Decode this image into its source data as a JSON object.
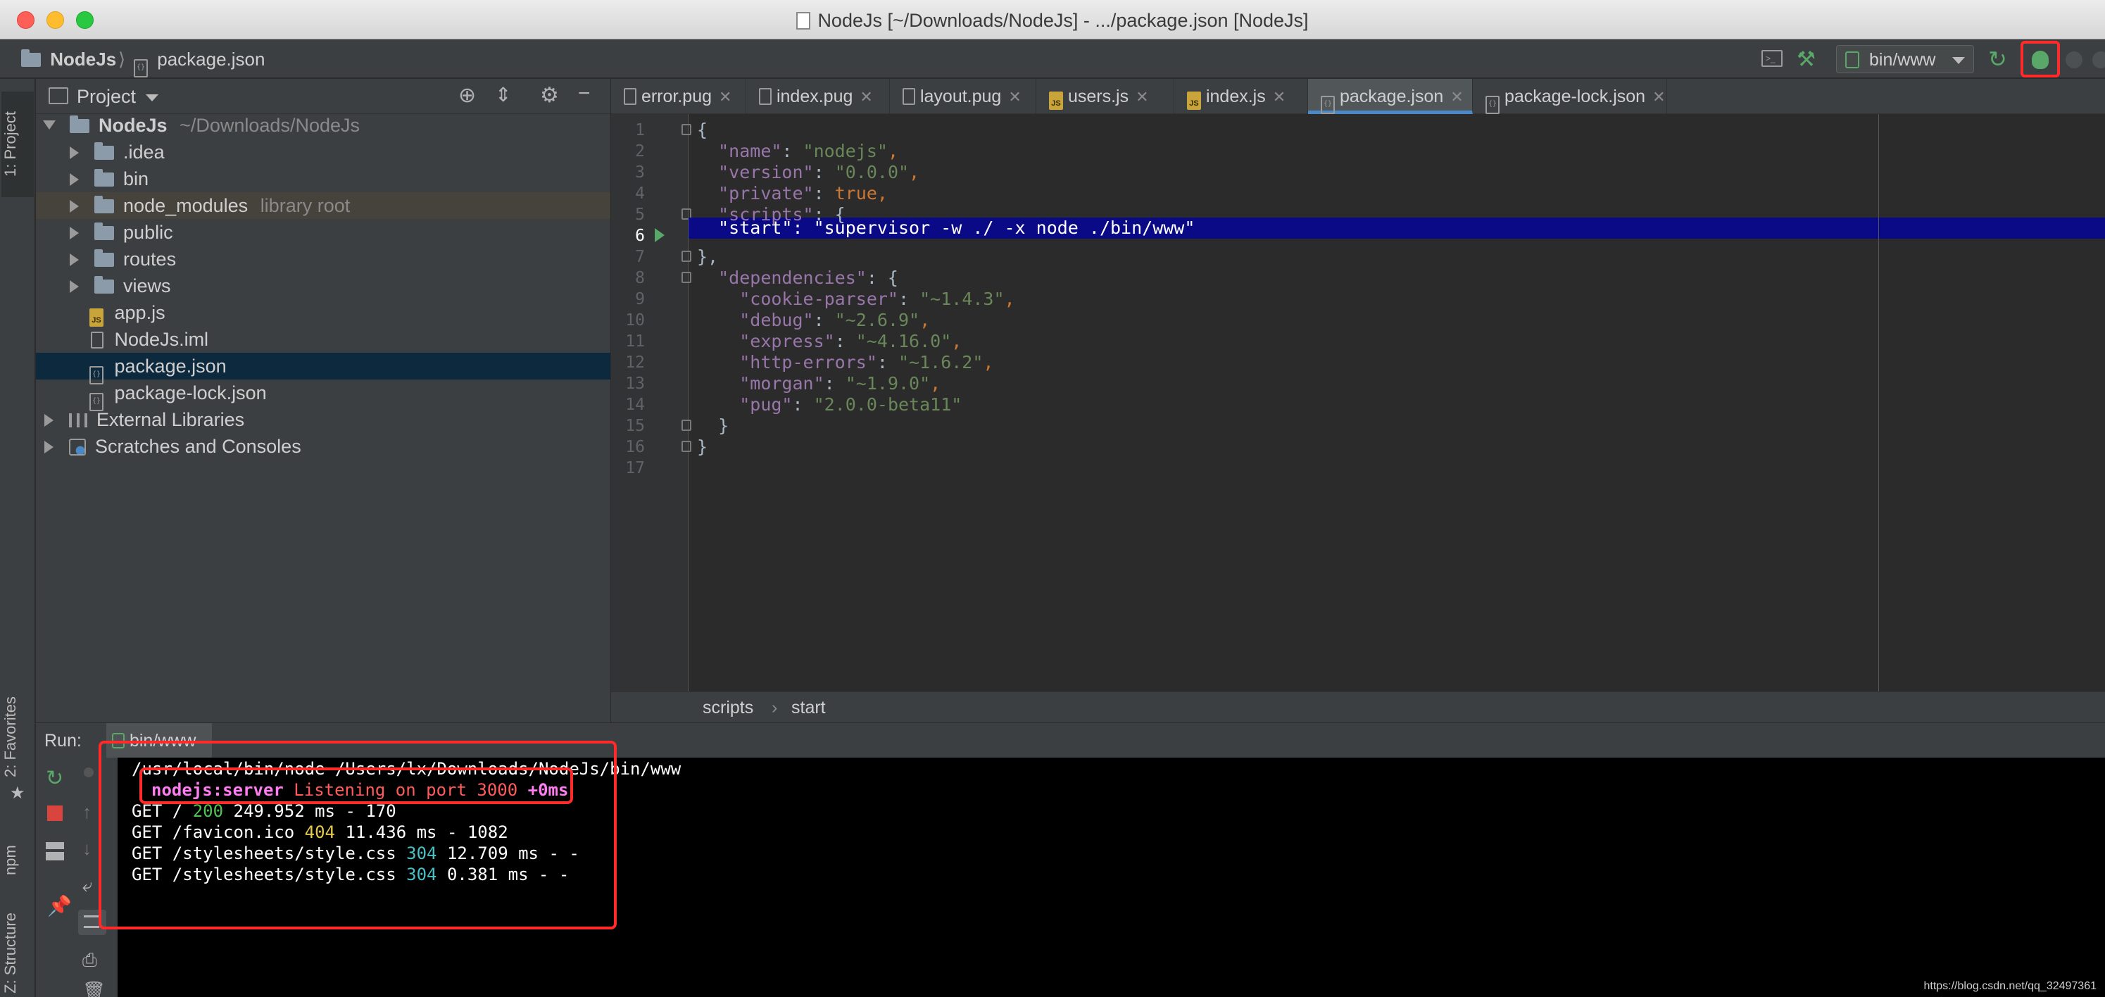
{
  "window": {
    "title": "NodeJs [~/Downloads/NodeJs] - .../package.json [NodeJs]"
  },
  "navbar": {
    "project": "NodeJs",
    "file": "package.json",
    "run_config": "bin/www"
  },
  "left_strip": {
    "project_tab": "1: Project",
    "favorites_tab": "2: Favorites",
    "npm_tab": "npm",
    "structure_tab": "Z: Structure"
  },
  "project_panel": {
    "title": "Project",
    "tree": [
      {
        "label": "NodeJs",
        "hint": "~/Downloads/NodeJs"
      },
      {
        "label": ".idea"
      },
      {
        "label": "bin"
      },
      {
        "label": "node_modules",
        "hint": "library root"
      },
      {
        "label": "public"
      },
      {
        "label": "routes"
      },
      {
        "label": "views"
      },
      {
        "label": "app.js"
      },
      {
        "label": "NodeJs.iml"
      },
      {
        "label": "package.json"
      },
      {
        "label": "package-lock.json"
      },
      {
        "label": "External Libraries"
      },
      {
        "label": "Scratches and Consoles"
      }
    ]
  },
  "editor": {
    "tabs": [
      "error.pug",
      "index.pug",
      "layout.pug",
      "users.js",
      "index.js",
      "package.json",
      "package-lock.json"
    ],
    "active_tab": "package.json",
    "line_numbers": [
      "1",
      "2",
      "3",
      "4",
      "5",
      "6",
      "7",
      "8",
      "9",
      "10",
      "11",
      "12",
      "13",
      "14",
      "15",
      "16",
      "17"
    ],
    "code": {
      "l1": "{",
      "name_key": "\"name\"",
      "name_val": "\"nodejs\"",
      "version_key": "\"version\"",
      "version_val": "\"0.0.0\"",
      "private_key": "\"private\"",
      "private_val": "true",
      "scripts_key": "\"scripts\"",
      "start_line": "  \"start\": \"supervisor -w ./ -x node ./bin/www\"",
      "l7": "},",
      "deps_key": "\"dependencies\"",
      "dep_cookie_key": "\"cookie-parser\"",
      "dep_cookie_val": "\"~1.4.3\"",
      "dep_debug_key": "\"debug\"",
      "dep_debug_val": "\"~2.6.9\"",
      "dep_express_key": "\"express\"",
      "dep_express_val": "\"~4.16.0\"",
      "dep_http_key": "\"http-errors\"",
      "dep_http_val": "\"~1.6.2\"",
      "dep_morgan_key": "\"morgan\"",
      "dep_morgan_val": "\"~1.9.0\"",
      "dep_pug_key": "\"pug\"",
      "dep_pug_val": "\"2.0.0-beta11\"",
      "l15": "}",
      "l16": "}"
    },
    "breadcrumb": [
      "scripts",
      "start"
    ]
  },
  "run_panel": {
    "label": "Run:",
    "tab": "bin/www",
    "console": {
      "cmd": "/usr/local/bin/node /Users/lx/Downloads/NodeJs/bin/www",
      "server_tag": "nodejs:server",
      "server_msg": "Listening on port 3000",
      "server_time": "+0ms",
      "req1_a": "GET / ",
      "req1_code": "200",
      "req1_b": " 249.952 ms - 170",
      "req2_a": "GET /favicon.ico ",
      "req2_code": "404",
      "req2_b": " 11.436 ms - 1082",
      "req3_a": "GET /stylesheets/style.css ",
      "req3_code": "304",
      "req3_b": " 12.709 ms - -",
      "req4_a": "GET /stylesheets/style.css ",
      "req4_code": "304",
      "req4_b": " 0.381 ms - -"
    }
  },
  "watermark": "https://blog.csdn.net/qq_32497361",
  "colors": {
    "highlight_box": "#ff2a2a",
    "selection": "#0a0a86",
    "accent": "#4a88c7"
  }
}
